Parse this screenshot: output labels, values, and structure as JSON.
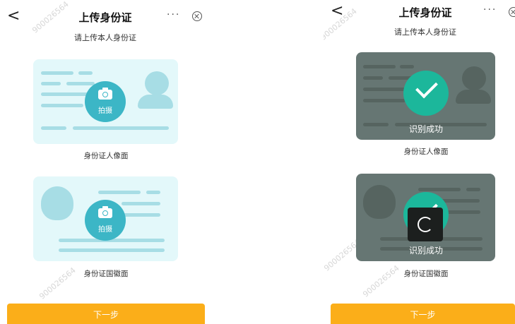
{
  "left": {
    "title": "上传身份证",
    "back_glyph": "<",
    "more_glyph": "···",
    "subtitle": "请上传本人身份证",
    "front_card": {
      "camera_label": "拍摄",
      "label": "身份证人像面",
      "icon": "camera-icon"
    },
    "back_card": {
      "camera_label": "拍摄",
      "label": "身份证国徽面",
      "icon": "camera-icon"
    },
    "next_button": "下一步"
  },
  "right": {
    "title": "上传身份证",
    "back_glyph": "<",
    "more_glyph": "···",
    "subtitle": "请上传本人身份证",
    "front_card": {
      "status": "识别成功",
      "label": "身份证人像面",
      "icon": "check-icon"
    },
    "back_card": {
      "status": "识别成功",
      "label": "身份证国徽面",
      "icon": "loading-spinner-icon"
    },
    "next_button": "下一步"
  },
  "colors": {
    "accent_orange": "#fbae19",
    "camera_teal": "#3cb6c6",
    "success_green": "#1cb79b",
    "card_light": "#e3f8fa",
    "card_dark": "#667673"
  },
  "watermark": "900026564"
}
